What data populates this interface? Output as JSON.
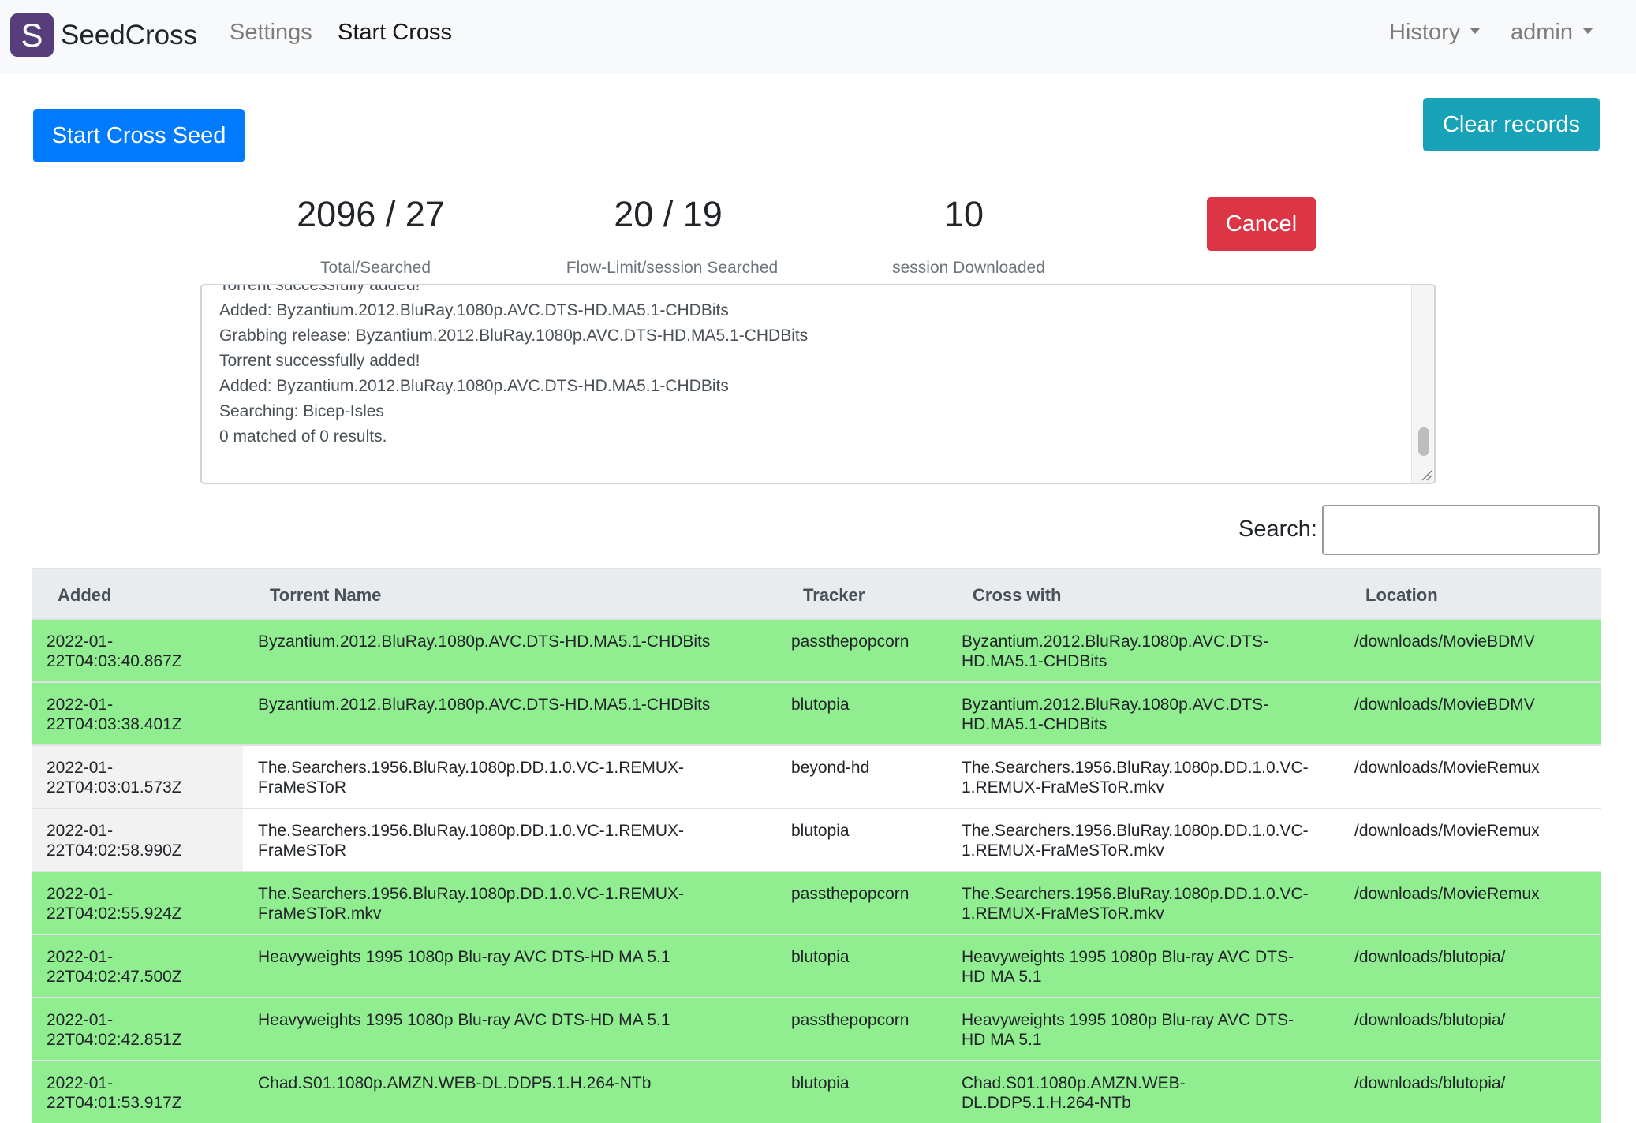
{
  "navbar": {
    "logo_letter": "S",
    "brand": "SeedCross",
    "links": {
      "settings": "Settings",
      "start_cross": "Start Cross"
    },
    "history": "History",
    "user": "admin"
  },
  "buttons": {
    "start": "Start Cross Seed",
    "clear": "Clear records",
    "cancel": "Cancel"
  },
  "stats": {
    "total": {
      "value": "2096 / 27",
      "label": "Total/Searched"
    },
    "flow": {
      "value": "20 / 19",
      "label": "Flow-Limit/session Searched"
    },
    "downloaded": {
      "value": "10",
      "label": "session Downloaded"
    }
  },
  "log": {
    "lines": [
      "Torrent successfully added!",
      "Added: Byzantium.2012.BluRay.1080p.AVC.DTS-HD.MA5.1-CHDBits",
      "Grabbing release: Byzantium.2012.BluRay.1080p.AVC.DTS-HD.MA5.1-CHDBits",
      "Torrent successfully added!",
      "Added: Byzantium.2012.BluRay.1080p.AVC.DTS-HD.MA5.1-CHDBits",
      "Searching: Bicep-Isles",
      "0 matched of 0 results."
    ]
  },
  "search": {
    "label": "Search:",
    "value": ""
  },
  "table": {
    "headers": [
      "Added",
      "Torrent Name",
      "Tracker",
      "Cross with",
      "Location"
    ],
    "rows": [
      {
        "added": [
          "2022-01-",
          "22T04:03:40.867Z"
        ],
        "name": [
          "Byzantium.2012.BluRay.1080p.AVC.DTS-HD.MA5.1-CHDBits"
        ],
        "tracker": "passthepopcorn",
        "cross": [
          "Byzantium.2012.BluRay.1080p.AVC.DTS-",
          "HD.MA5.1-CHDBits"
        ],
        "location": "/downloads/MovieBDMV",
        "color": "#90ee90"
      },
      {
        "added": [
          "2022-01-",
          "22T04:03:38.401Z"
        ],
        "name": [
          "Byzantium.2012.BluRay.1080p.AVC.DTS-HD.MA5.1-CHDBits"
        ],
        "tracker": "blutopia",
        "cross": [
          "Byzantium.2012.BluRay.1080p.AVC.DTS-",
          "HD.MA5.1-CHDBits"
        ],
        "location": "/downloads/MovieBDMV",
        "color": "#90ee90"
      },
      {
        "added": [
          "2022-01-",
          "22T04:03:01.573Z"
        ],
        "name": [
          "The.Searchers.1956.BluRay.1080p.DD.1.0.VC-1.REMUX-",
          "FraMeSToR"
        ],
        "tracker": "beyond-hd",
        "cross": [
          "The.Searchers.1956.BluRay.1080p.DD.1.0.VC-",
          "1.REMUX-FraMeSToR.mkv"
        ],
        "location": "/downloads/MovieRemux",
        "color": "#ffffff"
      },
      {
        "added": [
          "2022-01-",
          "22T04:02:58.990Z"
        ],
        "name": [
          "The.Searchers.1956.BluRay.1080p.DD.1.0.VC-1.REMUX-",
          "FraMeSToR"
        ],
        "tracker": "blutopia",
        "cross": [
          "The.Searchers.1956.BluRay.1080p.DD.1.0.VC-",
          "1.REMUX-FraMeSToR.mkv"
        ],
        "location": "/downloads/MovieRemux",
        "color": "#ffffff"
      },
      {
        "added": [
          "2022-01-",
          "22T04:02:55.924Z"
        ],
        "name": [
          "The.Searchers.1956.BluRay.1080p.DD.1.0.VC-1.REMUX-",
          "FraMeSToR.mkv"
        ],
        "tracker": "passthepopcorn",
        "cross": [
          "The.Searchers.1956.BluRay.1080p.DD.1.0.VC-",
          "1.REMUX-FraMeSToR.mkv"
        ],
        "location": "/downloads/MovieRemux",
        "color": "#90ee90"
      },
      {
        "added": [
          "2022-01-",
          "22T04:02:47.500Z"
        ],
        "name": [
          "Heavyweights 1995 1080p Blu-ray AVC DTS-HD MA 5.1"
        ],
        "tracker": "blutopia",
        "cross": [
          "Heavyweights 1995 1080p Blu-ray AVC DTS-",
          "HD MA 5.1"
        ],
        "location": "/downloads/blutopia/",
        "color": "#90ee90"
      },
      {
        "added": [
          "2022-01-",
          "22T04:02:42.851Z"
        ],
        "name": [
          "Heavyweights 1995 1080p Blu-ray AVC DTS-HD MA 5.1"
        ],
        "tracker": "passthepopcorn",
        "cross": [
          "Heavyweights 1995 1080p Blu-ray AVC DTS-",
          "HD MA 5.1"
        ],
        "location": "/downloads/blutopia/",
        "color": "#90ee90"
      },
      {
        "added": [
          "2022-01-",
          "22T04:01:53.917Z"
        ],
        "name": [
          "Chad.S01.1080p.AMZN.WEB-DL.DDP5.1.H.264-NTb"
        ],
        "tracker": "blutopia",
        "cross": [
          "Chad.S01.1080p.AMZN.WEB-",
          "DL.DDP5.1.H.264-NTb"
        ],
        "location": "/downloads/blutopia/",
        "color": "#90ee90"
      }
    ]
  }
}
